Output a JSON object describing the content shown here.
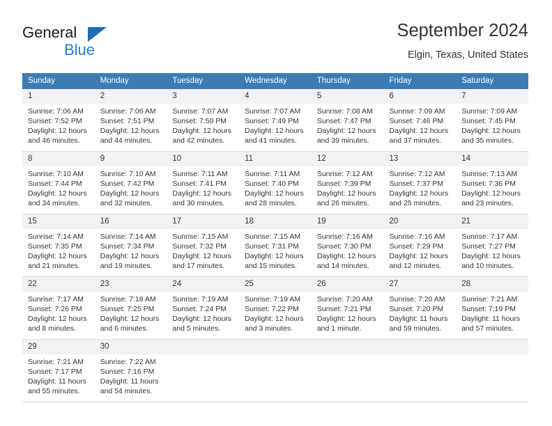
{
  "logo": {
    "word_top": "General",
    "word_bottom": "Blue",
    "triangle_color": "#1e6cb5",
    "blue_text_color": "#1f7fd0"
  },
  "header": {
    "title": "September 2024",
    "subtitle": "Elgin, Texas, United States"
  },
  "theme": {
    "header_blue": "#3b7cb5",
    "daynum_bg": "#f2f2f2",
    "row_divider": "#d7d7d7",
    "text": "#333333"
  },
  "weekdays": [
    "Sunday",
    "Monday",
    "Tuesday",
    "Wednesday",
    "Thursday",
    "Friday",
    "Saturday"
  ],
  "weeks": [
    [
      {
        "day": "1",
        "sunrise": "Sunrise: 7:06 AM",
        "sunset": "Sunset: 7:52 PM",
        "daylight1": "Daylight: 12 hours",
        "daylight2": "and 46 minutes."
      },
      {
        "day": "2",
        "sunrise": "Sunrise: 7:06 AM",
        "sunset": "Sunset: 7:51 PM",
        "daylight1": "Daylight: 12 hours",
        "daylight2": "and 44 minutes."
      },
      {
        "day": "3",
        "sunrise": "Sunrise: 7:07 AM",
        "sunset": "Sunset: 7:50 PM",
        "daylight1": "Daylight: 12 hours",
        "daylight2": "and 42 minutes."
      },
      {
        "day": "4",
        "sunrise": "Sunrise: 7:07 AM",
        "sunset": "Sunset: 7:49 PM",
        "daylight1": "Daylight: 12 hours",
        "daylight2": "and 41 minutes."
      },
      {
        "day": "5",
        "sunrise": "Sunrise: 7:08 AM",
        "sunset": "Sunset: 7:47 PM",
        "daylight1": "Daylight: 12 hours",
        "daylight2": "and 39 minutes."
      },
      {
        "day": "6",
        "sunrise": "Sunrise: 7:09 AM",
        "sunset": "Sunset: 7:46 PM",
        "daylight1": "Daylight: 12 hours",
        "daylight2": "and 37 minutes."
      },
      {
        "day": "7",
        "sunrise": "Sunrise: 7:09 AM",
        "sunset": "Sunset: 7:45 PM",
        "daylight1": "Daylight: 12 hours",
        "daylight2": "and 35 minutes."
      }
    ],
    [
      {
        "day": "8",
        "sunrise": "Sunrise: 7:10 AM",
        "sunset": "Sunset: 7:44 PM",
        "daylight1": "Daylight: 12 hours",
        "daylight2": "and 34 minutes."
      },
      {
        "day": "9",
        "sunrise": "Sunrise: 7:10 AM",
        "sunset": "Sunset: 7:42 PM",
        "daylight1": "Daylight: 12 hours",
        "daylight2": "and 32 minutes."
      },
      {
        "day": "10",
        "sunrise": "Sunrise: 7:11 AM",
        "sunset": "Sunset: 7:41 PM",
        "daylight1": "Daylight: 12 hours",
        "daylight2": "and 30 minutes."
      },
      {
        "day": "11",
        "sunrise": "Sunrise: 7:11 AM",
        "sunset": "Sunset: 7:40 PM",
        "daylight1": "Daylight: 12 hours",
        "daylight2": "and 28 minutes."
      },
      {
        "day": "12",
        "sunrise": "Sunrise: 7:12 AM",
        "sunset": "Sunset: 7:39 PM",
        "daylight1": "Daylight: 12 hours",
        "daylight2": "and 26 minutes."
      },
      {
        "day": "13",
        "sunrise": "Sunrise: 7:12 AM",
        "sunset": "Sunset: 7:37 PM",
        "daylight1": "Daylight: 12 hours",
        "daylight2": "and 25 minutes."
      },
      {
        "day": "14",
        "sunrise": "Sunrise: 7:13 AM",
        "sunset": "Sunset: 7:36 PM",
        "daylight1": "Daylight: 12 hours",
        "daylight2": "and 23 minutes."
      }
    ],
    [
      {
        "day": "15",
        "sunrise": "Sunrise: 7:14 AM",
        "sunset": "Sunset: 7:35 PM",
        "daylight1": "Daylight: 12 hours",
        "daylight2": "and 21 minutes."
      },
      {
        "day": "16",
        "sunrise": "Sunrise: 7:14 AM",
        "sunset": "Sunset: 7:34 PM",
        "daylight1": "Daylight: 12 hours",
        "daylight2": "and 19 minutes."
      },
      {
        "day": "17",
        "sunrise": "Sunrise: 7:15 AM",
        "sunset": "Sunset: 7:32 PM",
        "daylight1": "Daylight: 12 hours",
        "daylight2": "and 17 minutes."
      },
      {
        "day": "18",
        "sunrise": "Sunrise: 7:15 AM",
        "sunset": "Sunset: 7:31 PM",
        "daylight1": "Daylight: 12 hours",
        "daylight2": "and 15 minutes."
      },
      {
        "day": "19",
        "sunrise": "Sunrise: 7:16 AM",
        "sunset": "Sunset: 7:30 PM",
        "daylight1": "Daylight: 12 hours",
        "daylight2": "and 14 minutes."
      },
      {
        "day": "20",
        "sunrise": "Sunrise: 7:16 AM",
        "sunset": "Sunset: 7:29 PM",
        "daylight1": "Daylight: 12 hours",
        "daylight2": "and 12 minutes."
      },
      {
        "day": "21",
        "sunrise": "Sunrise: 7:17 AM",
        "sunset": "Sunset: 7:27 PM",
        "daylight1": "Daylight: 12 hours",
        "daylight2": "and 10 minutes."
      }
    ],
    [
      {
        "day": "22",
        "sunrise": "Sunrise: 7:17 AM",
        "sunset": "Sunset: 7:26 PM",
        "daylight1": "Daylight: 12 hours",
        "daylight2": "and 8 minutes."
      },
      {
        "day": "23",
        "sunrise": "Sunrise: 7:18 AM",
        "sunset": "Sunset: 7:25 PM",
        "daylight1": "Daylight: 12 hours",
        "daylight2": "and 6 minutes."
      },
      {
        "day": "24",
        "sunrise": "Sunrise: 7:19 AM",
        "sunset": "Sunset: 7:24 PM",
        "daylight1": "Daylight: 12 hours",
        "daylight2": "and 5 minutes."
      },
      {
        "day": "25",
        "sunrise": "Sunrise: 7:19 AM",
        "sunset": "Sunset: 7:22 PM",
        "daylight1": "Daylight: 12 hours",
        "daylight2": "and 3 minutes."
      },
      {
        "day": "26",
        "sunrise": "Sunrise: 7:20 AM",
        "sunset": "Sunset: 7:21 PM",
        "daylight1": "Daylight: 12 hours",
        "daylight2": "and 1 minute."
      },
      {
        "day": "27",
        "sunrise": "Sunrise: 7:20 AM",
        "sunset": "Sunset: 7:20 PM",
        "daylight1": "Daylight: 11 hours",
        "daylight2": "and 59 minutes."
      },
      {
        "day": "28",
        "sunrise": "Sunrise: 7:21 AM",
        "sunset": "Sunset: 7:19 PM",
        "daylight1": "Daylight: 11 hours",
        "daylight2": "and 57 minutes."
      }
    ],
    [
      {
        "day": "29",
        "sunrise": "Sunrise: 7:21 AM",
        "sunset": "Sunset: 7:17 PM",
        "daylight1": "Daylight: 11 hours",
        "daylight2": "and 55 minutes."
      },
      {
        "day": "30",
        "sunrise": "Sunrise: 7:22 AM",
        "sunset": "Sunset: 7:16 PM",
        "daylight1": "Daylight: 11 hours",
        "daylight2": "and 54 minutes."
      },
      {
        "day": "",
        "sunrise": "",
        "sunset": "",
        "daylight1": "",
        "daylight2": ""
      },
      {
        "day": "",
        "sunrise": "",
        "sunset": "",
        "daylight1": "",
        "daylight2": ""
      },
      {
        "day": "",
        "sunrise": "",
        "sunset": "",
        "daylight1": "",
        "daylight2": ""
      },
      {
        "day": "",
        "sunrise": "",
        "sunset": "",
        "daylight1": "",
        "daylight2": ""
      },
      {
        "day": "",
        "sunrise": "",
        "sunset": "",
        "daylight1": "",
        "daylight2": ""
      }
    ]
  ]
}
